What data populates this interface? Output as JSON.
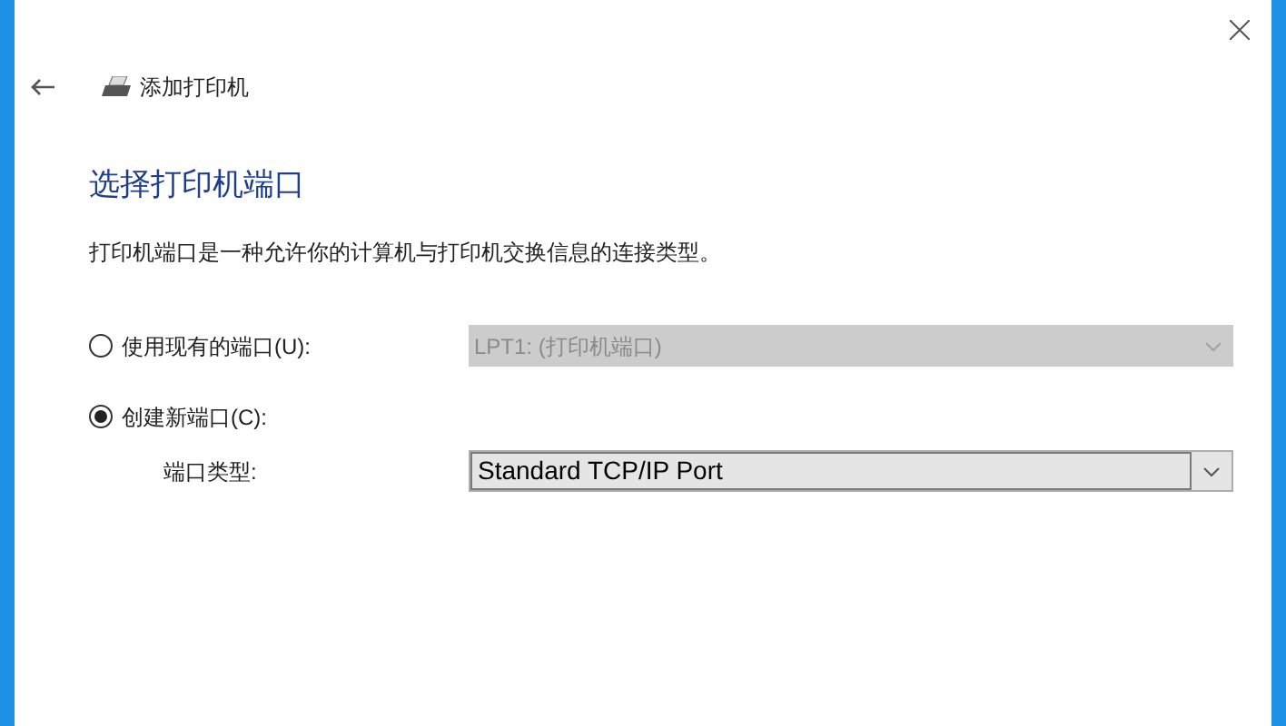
{
  "window": {
    "title": "添加打印机"
  },
  "heading": "选择打印机端口",
  "description": "打印机端口是一种允许你的计算机与打印机交换信息的连接类型。",
  "options": [
    {
      "label": "使用现有的端口(U):",
      "selected": false,
      "dropdown": {
        "value": "LPT1: (打印机端口)",
        "disabled": true
      }
    },
    {
      "label": "创建新端口(C):",
      "selected": true
    }
  ],
  "port_type": {
    "label": "端口类型:",
    "dropdown": {
      "value": "Standard TCP/IP Port",
      "disabled": false
    }
  }
}
